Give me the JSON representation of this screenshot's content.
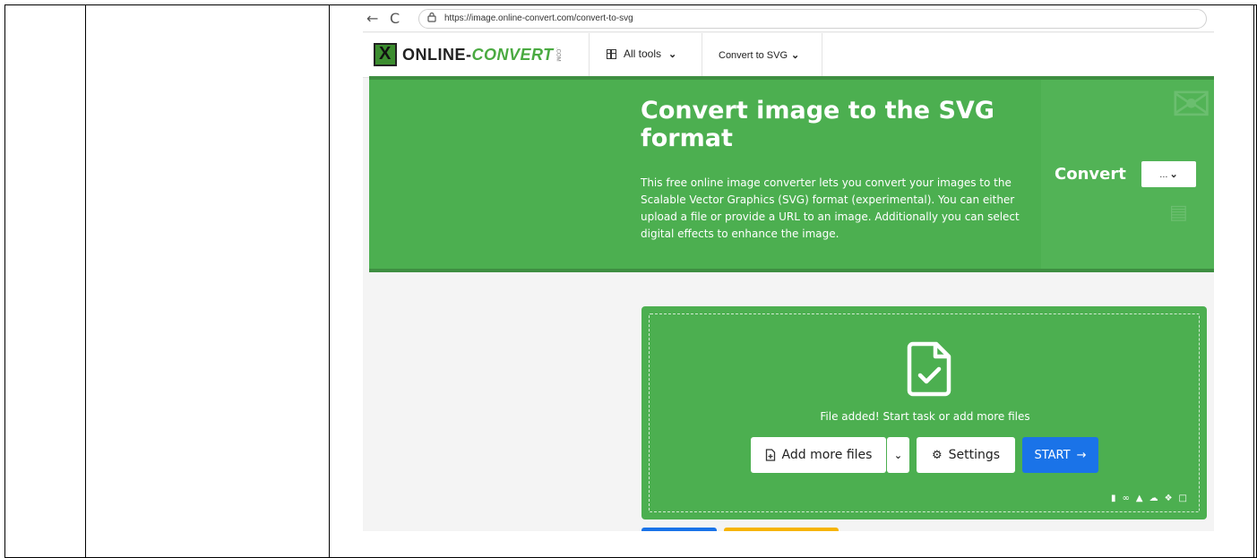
{
  "browser": {
    "url": "https://image.online-convert.com/convert-to-svg",
    "back_icon": "←",
    "reload_icon": "C",
    "lock_icon": "🔒"
  },
  "header": {
    "logo_part1": "ONLINE-",
    "logo_part2": "CONVERT",
    "logo_com": ".COM",
    "all_tools": "All tools",
    "convert_to": "Convert to SVG"
  },
  "hero": {
    "title": "Convert image to the SVG format",
    "description": "This free online image converter lets you convert your images to the Scalable Vector Graphics (SVG) format (experimental). You can either upload a file or provide a URL to an image. Additionally you can select digital effects to enhance the image.",
    "convert_label": "Convert",
    "convert_select_value": "..."
  },
  "upload": {
    "status": "File added! Start task or add more files",
    "add_more": "Add more files",
    "settings": "Settings",
    "start": "START"
  },
  "colors": {
    "brand_green": "#4caf50",
    "start_blue": "#1a73e8"
  }
}
